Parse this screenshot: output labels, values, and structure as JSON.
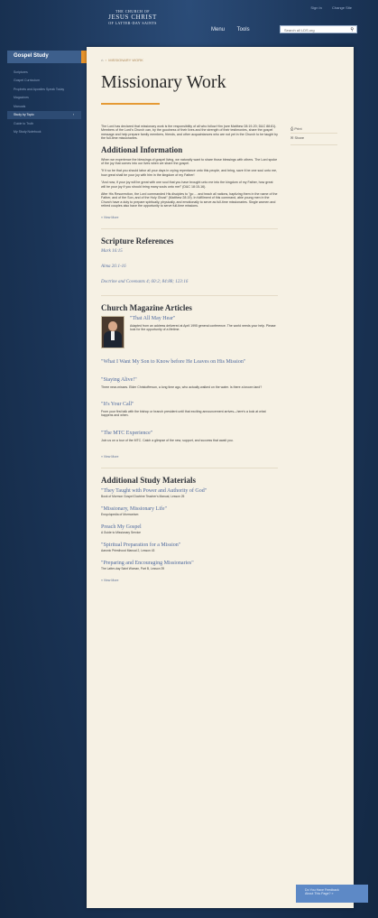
{
  "brand": {
    "line1": "THE CHURCH OF",
    "line2": "JESUS CHRIST",
    "line3": "OF LATTER-DAY SAINTS"
  },
  "toplinks": [
    "Sign In",
    "Change Site"
  ],
  "topnav": [
    "Menu",
    "Tools"
  ],
  "search": {
    "placeholder": "Search all LDS.org"
  },
  "sidebar": {
    "title": "Gospel Study",
    "items": [
      {
        "label": "Scriptures"
      },
      {
        "label": "Gospel Curriculum"
      },
      {
        "label": "Prophets and Apostles Speak Today"
      },
      {
        "label": "Magazines"
      },
      {
        "label": "Manuals"
      },
      {
        "label": "Study by Topic"
      },
      {
        "label": "Guide to Truth"
      },
      {
        "label": "My Study Notebook"
      }
    ]
  },
  "breadcrumb": {
    "current": "MISSIONARY WORK"
  },
  "page": {
    "title": "Missionary Work"
  },
  "tools": {
    "print": "Print",
    "share": "Share"
  },
  "intro": "The Lord has declared that missionary work is the responsibility of all who follow Him (see Matthew 28:19-20; D&C 88:81). Members of the Lord's Church can, by the goodness of their lives and the strength of their testimonies, share the gospel message and help prepare family members, friends, and other acquaintances who are not yet in the Church to be taught by the full-time missionaries.",
  "additional": {
    "heading": "Additional Information",
    "paragraphs": [
      "When we experience the blessings of gospel living, we naturally want to share those blessings with others. The Lord spoke of the joy that comes into our lives when we share the gospel.",
      "\"If it so be that you should labor all your days in crying repentance unto this people, and bring, save it be one soul unto me, how great shall be your joy with him in the kingdom of my Father!",
      "\"And now, if your joy will be great with one soul that you have brought unto me into the kingdom of my Father, how great will be your joy if you should bring many souls unto me!\" (D&C 18:15-16).",
      "After His Resurrection, the Lord commanded His disciples to \"go ... and teach all nations, baptizing them in the name of the Father, and of the Son, and of the Holy Ghost\" (Matthew 28:19). In fulfillment of this command, able young men in the Church have a duty to prepare spiritually, physically, and emotionally to serve as full-time missionaries. Single women and retired couples also have the opportunity to serve full-time missions."
    ],
    "more": "» View More"
  },
  "scripture": {
    "heading": "Scripture References",
    "refs": [
      "Mark 16:15",
      "Alma 26:1-16",
      "Doctrine and Covenants 4; 60:2; 84:88; 123:16"
    ]
  },
  "magazine": {
    "heading": "Church Magazine Articles",
    "featured": {
      "title": "\"That All May Hear\"",
      "desc": "Adapted from an address delivered at April 1995 general conference. The world needs your help. Please look for the opportunity of a lifetime."
    },
    "articles": [
      {
        "title": "\"What I Want My Son to Know before He Leaves on His Mission\"",
        "desc": ""
      },
      {
        "title": "\"Staying Alive!\"",
        "desc": "Three near-misses. Elder Christofferson, a long time ago, who actually walked on the water. Is there a known land?"
      },
      {
        "title": "\"It's Your Call\"",
        "desc": "From your first talk with the bishop or branch president until that exciting announcement arrives—here's a look at what happens and when."
      },
      {
        "title": "\"The MTC Experience\"",
        "desc": "Join us on a tour of the MTC. Catch a glimpse of the new, support, and success that await you."
      }
    ],
    "more": "» View More"
  },
  "study": {
    "heading": "Additional Study Materials",
    "items": [
      {
        "title": "\"They Taught with Power and Authority of God\"",
        "src": "Book of Mormon Gospel Doctrine Teacher's Manual, Lesson 25"
      },
      {
        "title": "\"Missionary, Missionary Life\"",
        "src": "Encyclopedia of Mormonism"
      },
      {
        "title": "Preach My Gospel",
        "src": "A Guide to Missionary Service"
      },
      {
        "title": "\"Spiritual Preparation for a Mission\"",
        "src": "Aaronic Priesthood Manual 2, Lesson 43"
      },
      {
        "title": "\"Preparing and Encouraging Missionaries\"",
        "src": "The Latter-day Saint Woman, Part B, Lesson 39"
      }
    ],
    "more": "» View More"
  },
  "feedback": {
    "line1": "Do You Have Feedback",
    "line2": "About This Page? »"
  },
  "colors": {
    "accent": "#e59a34",
    "background": "#1b3558",
    "link": "#4f6a9e",
    "paper": "#f6f1e4"
  }
}
